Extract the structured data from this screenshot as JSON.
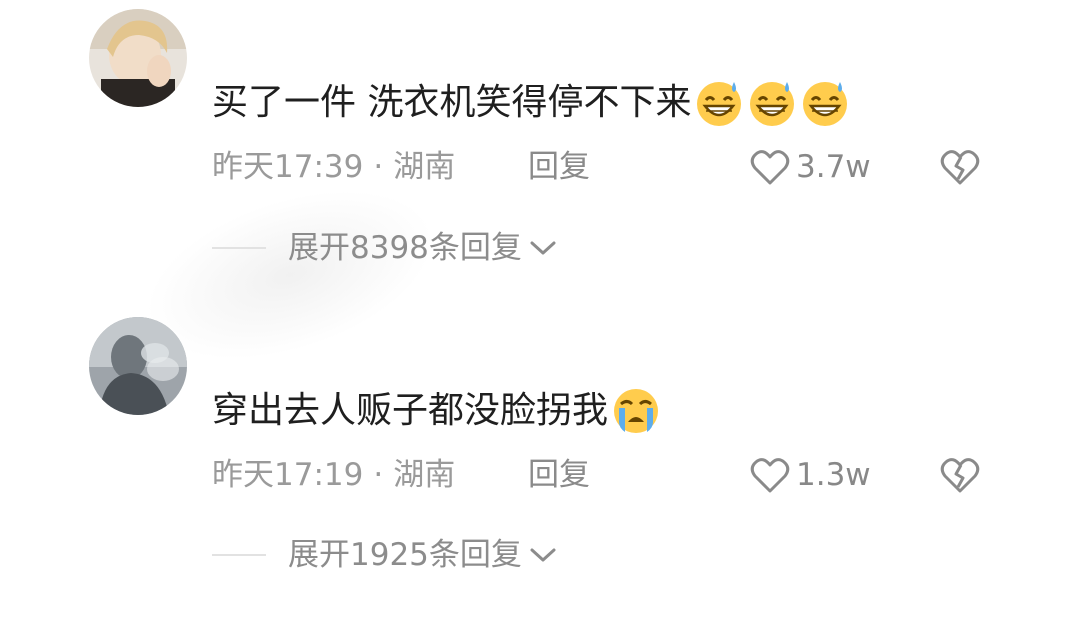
{
  "comments": [
    {
      "text": "买了一件 洗衣机笑得停不下来",
      "emoji_icon": "grinning-sweat-emoji",
      "emoji_count": 3,
      "time": "昨天17:39",
      "separator": "·",
      "location": "湖南",
      "reply_label": "回复",
      "likes": "3.7w",
      "expand_label": "展开8398条回复"
    },
    {
      "text": "穿出去人贩子都没脸拐我",
      "emoji_icon": "loudly-crying-emoji",
      "emoji_count": 1,
      "time": "昨天17:19",
      "separator": "·",
      "location": "湖南",
      "reply_label": "回复",
      "likes": "1.3w",
      "expand_label": "展开1925条回复"
    }
  ],
  "colors": {
    "text_primary": "#1f1f1f",
    "text_meta": "#9a9a9a",
    "icon_gray": "#8a8a8a",
    "emoji_yellow": "#ffcc4d",
    "divider": "#e2e2e2"
  }
}
